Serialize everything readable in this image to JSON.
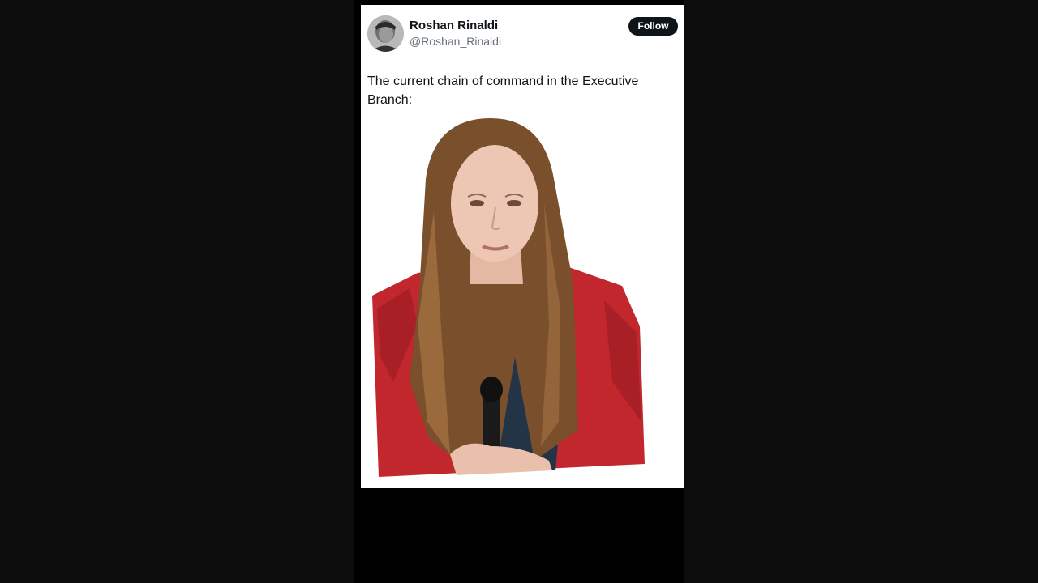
{
  "tweet": {
    "author_name": "Roshan Rinaldi",
    "author_handle": "@Roshan_Rinaldi",
    "follow_label": "Follow",
    "text": "The current chain of command in the Executive Branch:"
  },
  "icons": {
    "avatar": "profile-photo",
    "media": "person-cutout-photo"
  },
  "colors": {
    "page_background": "#0c0c0c",
    "card_background": "#ffffff",
    "follow_button": "#0f1419",
    "handle_text": "#66717b",
    "jacket": "#c1272d"
  }
}
